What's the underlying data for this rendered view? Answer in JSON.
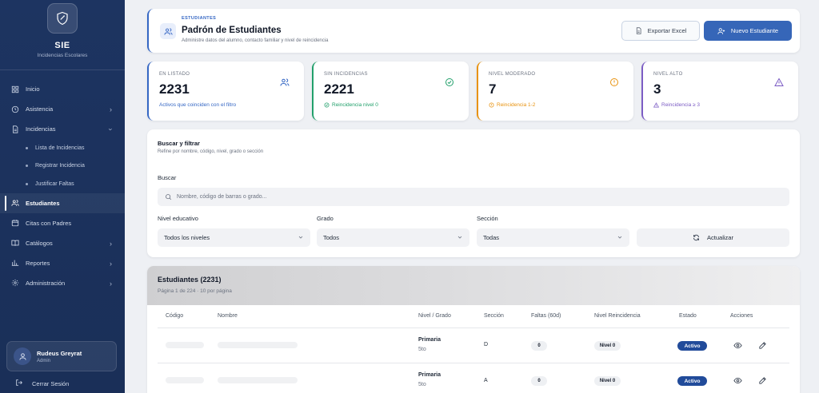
{
  "brand": {
    "title": "SIE",
    "subtitle": "Incidencias Escolares"
  },
  "nav": {
    "inicio": "Inicio",
    "asistencia": "Asistencia",
    "incidencias": "Incidencias",
    "sub_lista": "Lista de Incidencias",
    "sub_registrar": "Registrar Incidencia",
    "sub_justificar": "Justificar Faltas",
    "estudiantes": "Estudiantes",
    "citas": "Citas con Padres",
    "catalogos": "Catálogos",
    "reportes": "Reportes",
    "administracion": "Administración"
  },
  "user": {
    "name": "Rudeus Greyrat",
    "role": "Admin",
    "logout": "Cerrar Sesión"
  },
  "header": {
    "kicker": "ESTUDIANTES",
    "title": "Padrón de Estudiantes",
    "subtitle": "Administre datos del alumno, contacto familiar y nivel de reincidencia",
    "export_label": "Exportar Excel",
    "new_label": "Nuevo Estudiante"
  },
  "stats": [
    {
      "label": "EN LISTADO",
      "value": "2231",
      "note": "Activos que coinciden con el filtro",
      "color": "#3567c4",
      "icon": "users-icon"
    },
    {
      "label": "SIN INCIDENCIAS",
      "value": "2221",
      "note": "Reincidencia nivel 0",
      "color": "#22a06b",
      "icon": "check-circle-icon"
    },
    {
      "label": "NIVEL MODERADO",
      "value": "7",
      "note": "Reincidencia 1-2",
      "color": "#e8920e",
      "icon": "alert-circle-icon"
    },
    {
      "label": "NIVEL ALTO",
      "value": "3",
      "note": "Reincidencia ≥ 3",
      "color": "#7c5cc4",
      "icon": "warning-triangle-icon"
    }
  ],
  "filters": {
    "title": "Buscar y filtrar",
    "subtitle": "Refine por nombre, código, nivel, grado o sección",
    "search_label": "Buscar",
    "search_placeholder": "Nombre, código de barras o grado...",
    "nivel_label": "Nivel educativo",
    "nivel_value": "Todos los niveles",
    "grado_label": "Grado",
    "grado_value": "Todos",
    "seccion_label": "Sección",
    "seccion_value": "Todas",
    "refresh_label": "Actualizar"
  },
  "table": {
    "title": "Estudiantes (2231)",
    "subtitle": "Página 1 de 224 · 10 por página",
    "columns": [
      "Código",
      "Nombre",
      "Nivel / Grado",
      "Sección",
      "Faltas (60d)",
      "Nivel Reincidencia",
      "Estado",
      "Acciones"
    ],
    "rows": [
      {
        "nivel": "Primaria",
        "grado": "5to",
        "seccion": "D",
        "faltas": "0",
        "reincidencia": "Nivel 0",
        "estado": "Activo"
      },
      {
        "nivel": "Primaria",
        "grado": "5to",
        "seccion": "A",
        "faltas": "0",
        "reincidencia": "Nivel 0",
        "estado": "Activo"
      }
    ]
  }
}
